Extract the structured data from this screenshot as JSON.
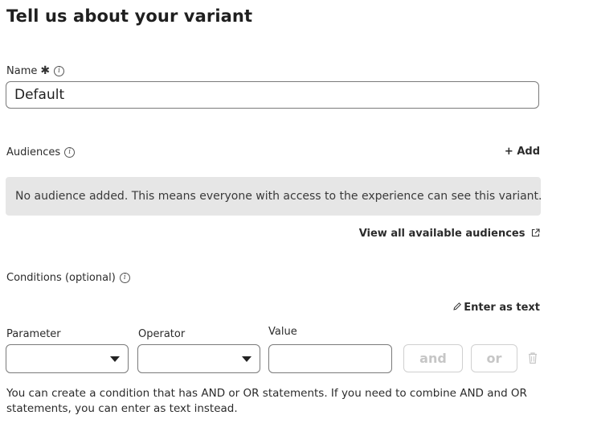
{
  "header": {
    "title": "Tell us about your variant"
  },
  "name_field": {
    "label": "Name",
    "required_mark": "✱",
    "value": "Default"
  },
  "audiences": {
    "label": "Audiences",
    "add_label": "+ Add",
    "empty_note": "No audience added. This means everyone with access to the experience can see this variant.",
    "view_all_label": "View all available audiences"
  },
  "conditions": {
    "label": "Conditions (optional)",
    "enter_as_text_label": "Enter as text",
    "parameter_label": "Parameter",
    "operator_label": "Operator",
    "value_label": "Value",
    "and_label": "and",
    "or_label": "or",
    "helper_text": "You can create a condition that has AND or OR statements. If you need to combine AND and OR statements, you can enter as text instead."
  }
}
